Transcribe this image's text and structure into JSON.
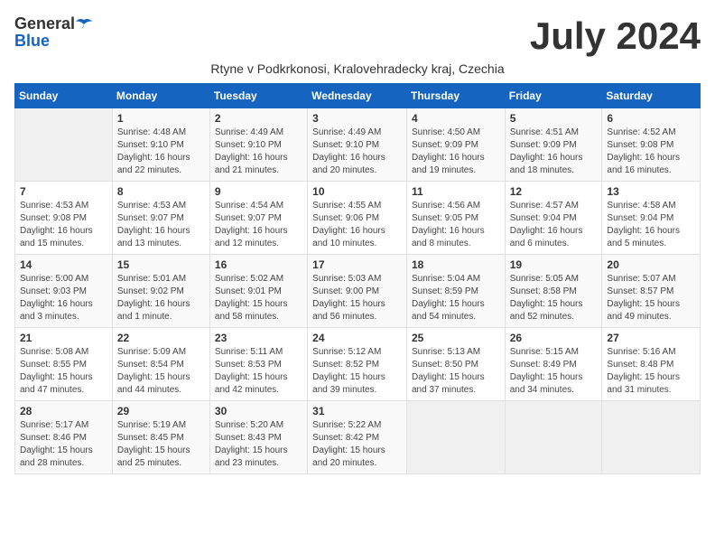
{
  "header": {
    "logo_general": "General",
    "logo_blue": "Blue",
    "month_title": "July 2024",
    "subtitle": "Rtyne v Podkrkonosi, Kralovehradecky kraj, Czechia"
  },
  "days_of_week": [
    "Sunday",
    "Monday",
    "Tuesday",
    "Wednesday",
    "Thursday",
    "Friday",
    "Saturday"
  ],
  "weeks": [
    {
      "days": [
        {
          "number": "",
          "info": ""
        },
        {
          "number": "1",
          "info": "Sunrise: 4:48 AM\nSunset: 9:10 PM\nDaylight: 16 hours\nand 22 minutes."
        },
        {
          "number": "2",
          "info": "Sunrise: 4:49 AM\nSunset: 9:10 PM\nDaylight: 16 hours\nand 21 minutes."
        },
        {
          "number": "3",
          "info": "Sunrise: 4:49 AM\nSunset: 9:10 PM\nDaylight: 16 hours\nand 20 minutes."
        },
        {
          "number": "4",
          "info": "Sunrise: 4:50 AM\nSunset: 9:09 PM\nDaylight: 16 hours\nand 19 minutes."
        },
        {
          "number": "5",
          "info": "Sunrise: 4:51 AM\nSunset: 9:09 PM\nDaylight: 16 hours\nand 18 minutes."
        },
        {
          "number": "6",
          "info": "Sunrise: 4:52 AM\nSunset: 9:08 PM\nDaylight: 16 hours\nand 16 minutes."
        }
      ]
    },
    {
      "days": [
        {
          "number": "7",
          "info": "Sunrise: 4:53 AM\nSunset: 9:08 PM\nDaylight: 16 hours\nand 15 minutes."
        },
        {
          "number": "8",
          "info": "Sunrise: 4:53 AM\nSunset: 9:07 PM\nDaylight: 16 hours\nand 13 minutes."
        },
        {
          "number": "9",
          "info": "Sunrise: 4:54 AM\nSunset: 9:07 PM\nDaylight: 16 hours\nand 12 minutes."
        },
        {
          "number": "10",
          "info": "Sunrise: 4:55 AM\nSunset: 9:06 PM\nDaylight: 16 hours\nand 10 minutes."
        },
        {
          "number": "11",
          "info": "Sunrise: 4:56 AM\nSunset: 9:05 PM\nDaylight: 16 hours\nand 8 minutes."
        },
        {
          "number": "12",
          "info": "Sunrise: 4:57 AM\nSunset: 9:04 PM\nDaylight: 16 hours\nand 6 minutes."
        },
        {
          "number": "13",
          "info": "Sunrise: 4:58 AM\nSunset: 9:04 PM\nDaylight: 16 hours\nand 5 minutes."
        }
      ]
    },
    {
      "days": [
        {
          "number": "14",
          "info": "Sunrise: 5:00 AM\nSunset: 9:03 PM\nDaylight: 16 hours\nand 3 minutes."
        },
        {
          "number": "15",
          "info": "Sunrise: 5:01 AM\nSunset: 9:02 PM\nDaylight: 16 hours\nand 1 minute."
        },
        {
          "number": "16",
          "info": "Sunrise: 5:02 AM\nSunset: 9:01 PM\nDaylight: 15 hours\nand 58 minutes."
        },
        {
          "number": "17",
          "info": "Sunrise: 5:03 AM\nSunset: 9:00 PM\nDaylight: 15 hours\nand 56 minutes."
        },
        {
          "number": "18",
          "info": "Sunrise: 5:04 AM\nSunset: 8:59 PM\nDaylight: 15 hours\nand 54 minutes."
        },
        {
          "number": "19",
          "info": "Sunrise: 5:05 AM\nSunset: 8:58 PM\nDaylight: 15 hours\nand 52 minutes."
        },
        {
          "number": "20",
          "info": "Sunrise: 5:07 AM\nSunset: 8:57 PM\nDaylight: 15 hours\nand 49 minutes."
        }
      ]
    },
    {
      "days": [
        {
          "number": "21",
          "info": "Sunrise: 5:08 AM\nSunset: 8:55 PM\nDaylight: 15 hours\nand 47 minutes."
        },
        {
          "number": "22",
          "info": "Sunrise: 5:09 AM\nSunset: 8:54 PM\nDaylight: 15 hours\nand 44 minutes."
        },
        {
          "number": "23",
          "info": "Sunrise: 5:11 AM\nSunset: 8:53 PM\nDaylight: 15 hours\nand 42 minutes."
        },
        {
          "number": "24",
          "info": "Sunrise: 5:12 AM\nSunset: 8:52 PM\nDaylight: 15 hours\nand 39 minutes."
        },
        {
          "number": "25",
          "info": "Sunrise: 5:13 AM\nSunset: 8:50 PM\nDaylight: 15 hours\nand 37 minutes."
        },
        {
          "number": "26",
          "info": "Sunrise: 5:15 AM\nSunset: 8:49 PM\nDaylight: 15 hours\nand 34 minutes."
        },
        {
          "number": "27",
          "info": "Sunrise: 5:16 AM\nSunset: 8:48 PM\nDaylight: 15 hours\nand 31 minutes."
        }
      ]
    },
    {
      "days": [
        {
          "number": "28",
          "info": "Sunrise: 5:17 AM\nSunset: 8:46 PM\nDaylight: 15 hours\nand 28 minutes."
        },
        {
          "number": "29",
          "info": "Sunrise: 5:19 AM\nSunset: 8:45 PM\nDaylight: 15 hours\nand 25 minutes."
        },
        {
          "number": "30",
          "info": "Sunrise: 5:20 AM\nSunset: 8:43 PM\nDaylight: 15 hours\nand 23 minutes."
        },
        {
          "number": "31",
          "info": "Sunrise: 5:22 AM\nSunset: 8:42 PM\nDaylight: 15 hours\nand 20 minutes."
        },
        {
          "number": "",
          "info": ""
        },
        {
          "number": "",
          "info": ""
        },
        {
          "number": "",
          "info": ""
        }
      ]
    }
  ]
}
